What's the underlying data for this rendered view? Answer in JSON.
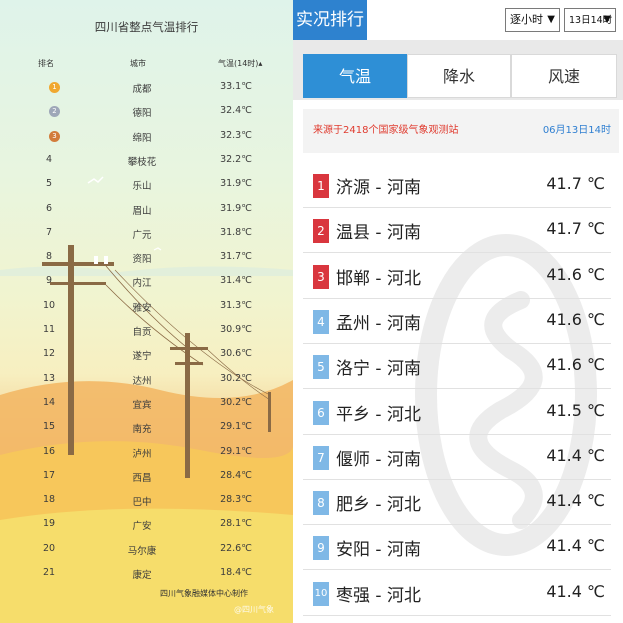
{
  "left_panel": {
    "title": "四川省整点气温排行",
    "headers": {
      "rank": "排名",
      "city": "城市",
      "temp": "气温(14时)▴"
    },
    "rows": [
      {
        "rank": "1",
        "city": "成都",
        "temp": "33.1℃",
        "medal": "gold"
      },
      {
        "rank": "2",
        "city": "德阳",
        "temp": "32.4℃",
        "medal": "silver"
      },
      {
        "rank": "3",
        "city": "绵阳",
        "temp": "32.3℃",
        "medal": "bronze"
      },
      {
        "rank": "4",
        "city": "攀枝花",
        "temp": "32.2℃"
      },
      {
        "rank": "5",
        "city": "乐山",
        "temp": "31.9℃"
      },
      {
        "rank": "6",
        "city": "眉山",
        "temp": "31.9℃"
      },
      {
        "rank": "7",
        "city": "广元",
        "temp": "31.8℃"
      },
      {
        "rank": "8",
        "city": "资阳",
        "temp": "31.7℃"
      },
      {
        "rank": "9",
        "city": "内江",
        "temp": "31.4℃"
      },
      {
        "rank": "10",
        "city": "雅安",
        "temp": "31.3℃"
      },
      {
        "rank": "11",
        "city": "自贡",
        "temp": "30.9℃"
      },
      {
        "rank": "12",
        "city": "遂宁",
        "temp": "30.6℃"
      },
      {
        "rank": "13",
        "city": "达州",
        "temp": "30.2℃"
      },
      {
        "rank": "14",
        "city": "宜宾",
        "temp": "30.2℃"
      },
      {
        "rank": "15",
        "city": "南充",
        "temp": "29.1℃"
      },
      {
        "rank": "16",
        "city": "泸州",
        "temp": "29.1℃"
      },
      {
        "rank": "17",
        "city": "西昌",
        "temp": "28.4℃"
      },
      {
        "rank": "18",
        "city": "巴中",
        "temp": "28.3℃"
      },
      {
        "rank": "19",
        "city": "广安",
        "temp": "28.1℃"
      },
      {
        "rank": "20",
        "city": "马尔康",
        "temp": "22.6℃"
      },
      {
        "rank": "21",
        "city": "康定",
        "temp": "18.4℃"
      }
    ],
    "credit": "四川气象融媒体中心制作",
    "watermark": "@四川气象"
  },
  "right_panel": {
    "app_title": "实况排行",
    "interval_select": "逐小时",
    "time_select": "13日14时",
    "tabs": [
      "气温",
      "降水",
      "风速"
    ],
    "active_tab": 0,
    "source_text": "来源于2418个国家级气象观测站",
    "datetime": "06月13日14时",
    "items": [
      {
        "rank": "1",
        "place": "济源 - 河南",
        "value": "41.7 ℃"
      },
      {
        "rank": "2",
        "place": "温县 - 河南",
        "value": "41.7 ℃"
      },
      {
        "rank": "3",
        "place": "邯郸 - 河北",
        "value": "41.6 ℃"
      },
      {
        "rank": "4",
        "place": "孟州 - 河南",
        "value": "41.6 ℃"
      },
      {
        "rank": "5",
        "place": "洛宁 - 河南",
        "value": "41.6 ℃"
      },
      {
        "rank": "6",
        "place": "平乡 - 河北",
        "value": "41.5 ℃"
      },
      {
        "rank": "7",
        "place": "偃师 - 河南",
        "value": "41.4 ℃"
      },
      {
        "rank": "8",
        "place": "肥乡 - 河北",
        "value": "41.4 ℃"
      },
      {
        "rank": "9",
        "place": "安阳 - 河南",
        "value": "41.4 ℃"
      },
      {
        "rank": "10",
        "place": "枣强 - 河北",
        "value": "41.4 ℃"
      }
    ]
  },
  "colors": {
    "accent_blue": "#2e82cf",
    "badge_red": "#d9363e",
    "badge_blue": "#7fb8e6",
    "source_red": "#e03b2f",
    "medal_gold": "#f0a830",
    "medal_silver": "#9ea7b8",
    "medal_bronze": "#d27c3b"
  }
}
